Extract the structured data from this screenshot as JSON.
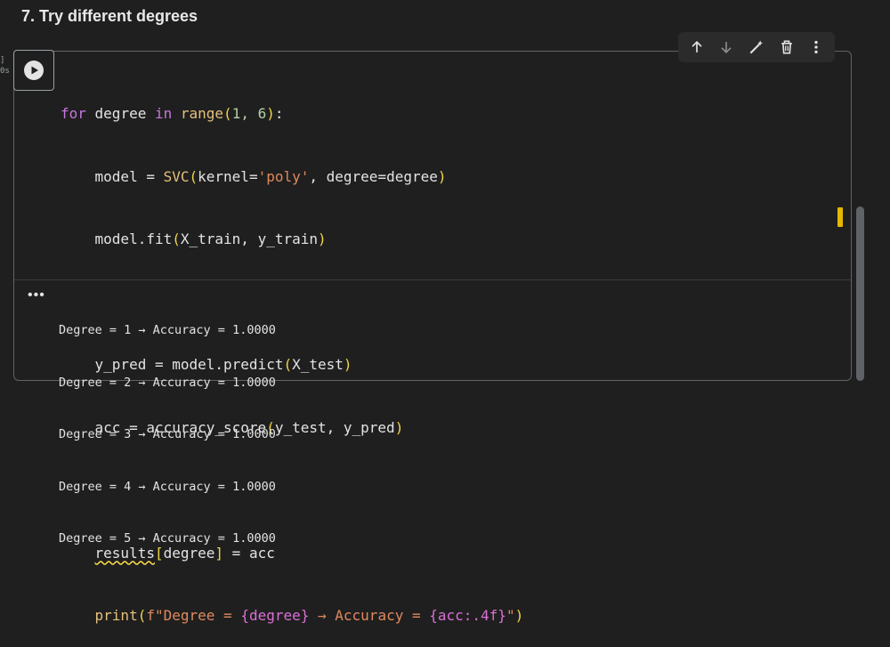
{
  "section": {
    "title": "7. Try different degrees"
  },
  "gutter": {
    "line1": "]",
    "line2": "0s"
  },
  "toolbar": {
    "icons": [
      "arrow-up-icon",
      "arrow-down-icon",
      "magic-edit-icon",
      "trash-icon",
      "more-vert-icon"
    ]
  },
  "code": {
    "l1": {
      "kw_for": "for",
      "t1": " degree ",
      "kw_in": "in",
      "t2": " ",
      "fn_range": "range",
      "p_open": "(",
      "args": "1, 6",
      "p_close": ")",
      "t3": ":"
    },
    "l2": {
      "indent": "    ",
      "t1": "model = ",
      "fn": "SVC",
      "p_open": "(",
      "a1": "kernel=",
      "str": "'poly'",
      "a2": ", degree=degree",
      "p_close": ")"
    },
    "l3": {
      "indent": "    ",
      "t1": "model.fit",
      "p_open": "(",
      "args": "X_train, y_train",
      "p_close": ")"
    },
    "l5": {
      "indent": "    ",
      "t1": "y_pred = model.predict",
      "p_open": "(",
      "args": "X_test",
      "p_close": ")"
    },
    "l6": {
      "indent": "    ",
      "t1": "acc = accuracy_score",
      "p_open": "(",
      "args": "y_test, y_pred",
      "p_close": ")"
    },
    "l8": {
      "indent": "    ",
      "var": "results",
      "b_open": "[",
      "idx": "degree",
      "b_close": "]",
      "t1": " = acc"
    },
    "l9": {
      "indent": "    ",
      "fn": "print",
      "p_open": "(",
      "s1": "f\"Degree = ",
      "f1": "{degree}",
      "s2": " → Accuracy = ",
      "f2": "{acc:.4f}",
      "s3": "\"",
      "p_close": ")"
    }
  },
  "output": {
    "more_label": "•••",
    "lines": [
      "Degree = 1 → Accuracy = 1.0000",
      "Degree = 2 → Accuracy = 1.0000",
      "Degree = 3 → Accuracy = 1.0000",
      "Degree = 4 → Accuracy = 1.0000",
      "Degree = 5 → Accuracy = 1.0000"
    ]
  },
  "colors": {
    "accent_marker": "#e5b800",
    "cell_border": "#5f6368",
    "background": "#1f1f1f"
  }
}
